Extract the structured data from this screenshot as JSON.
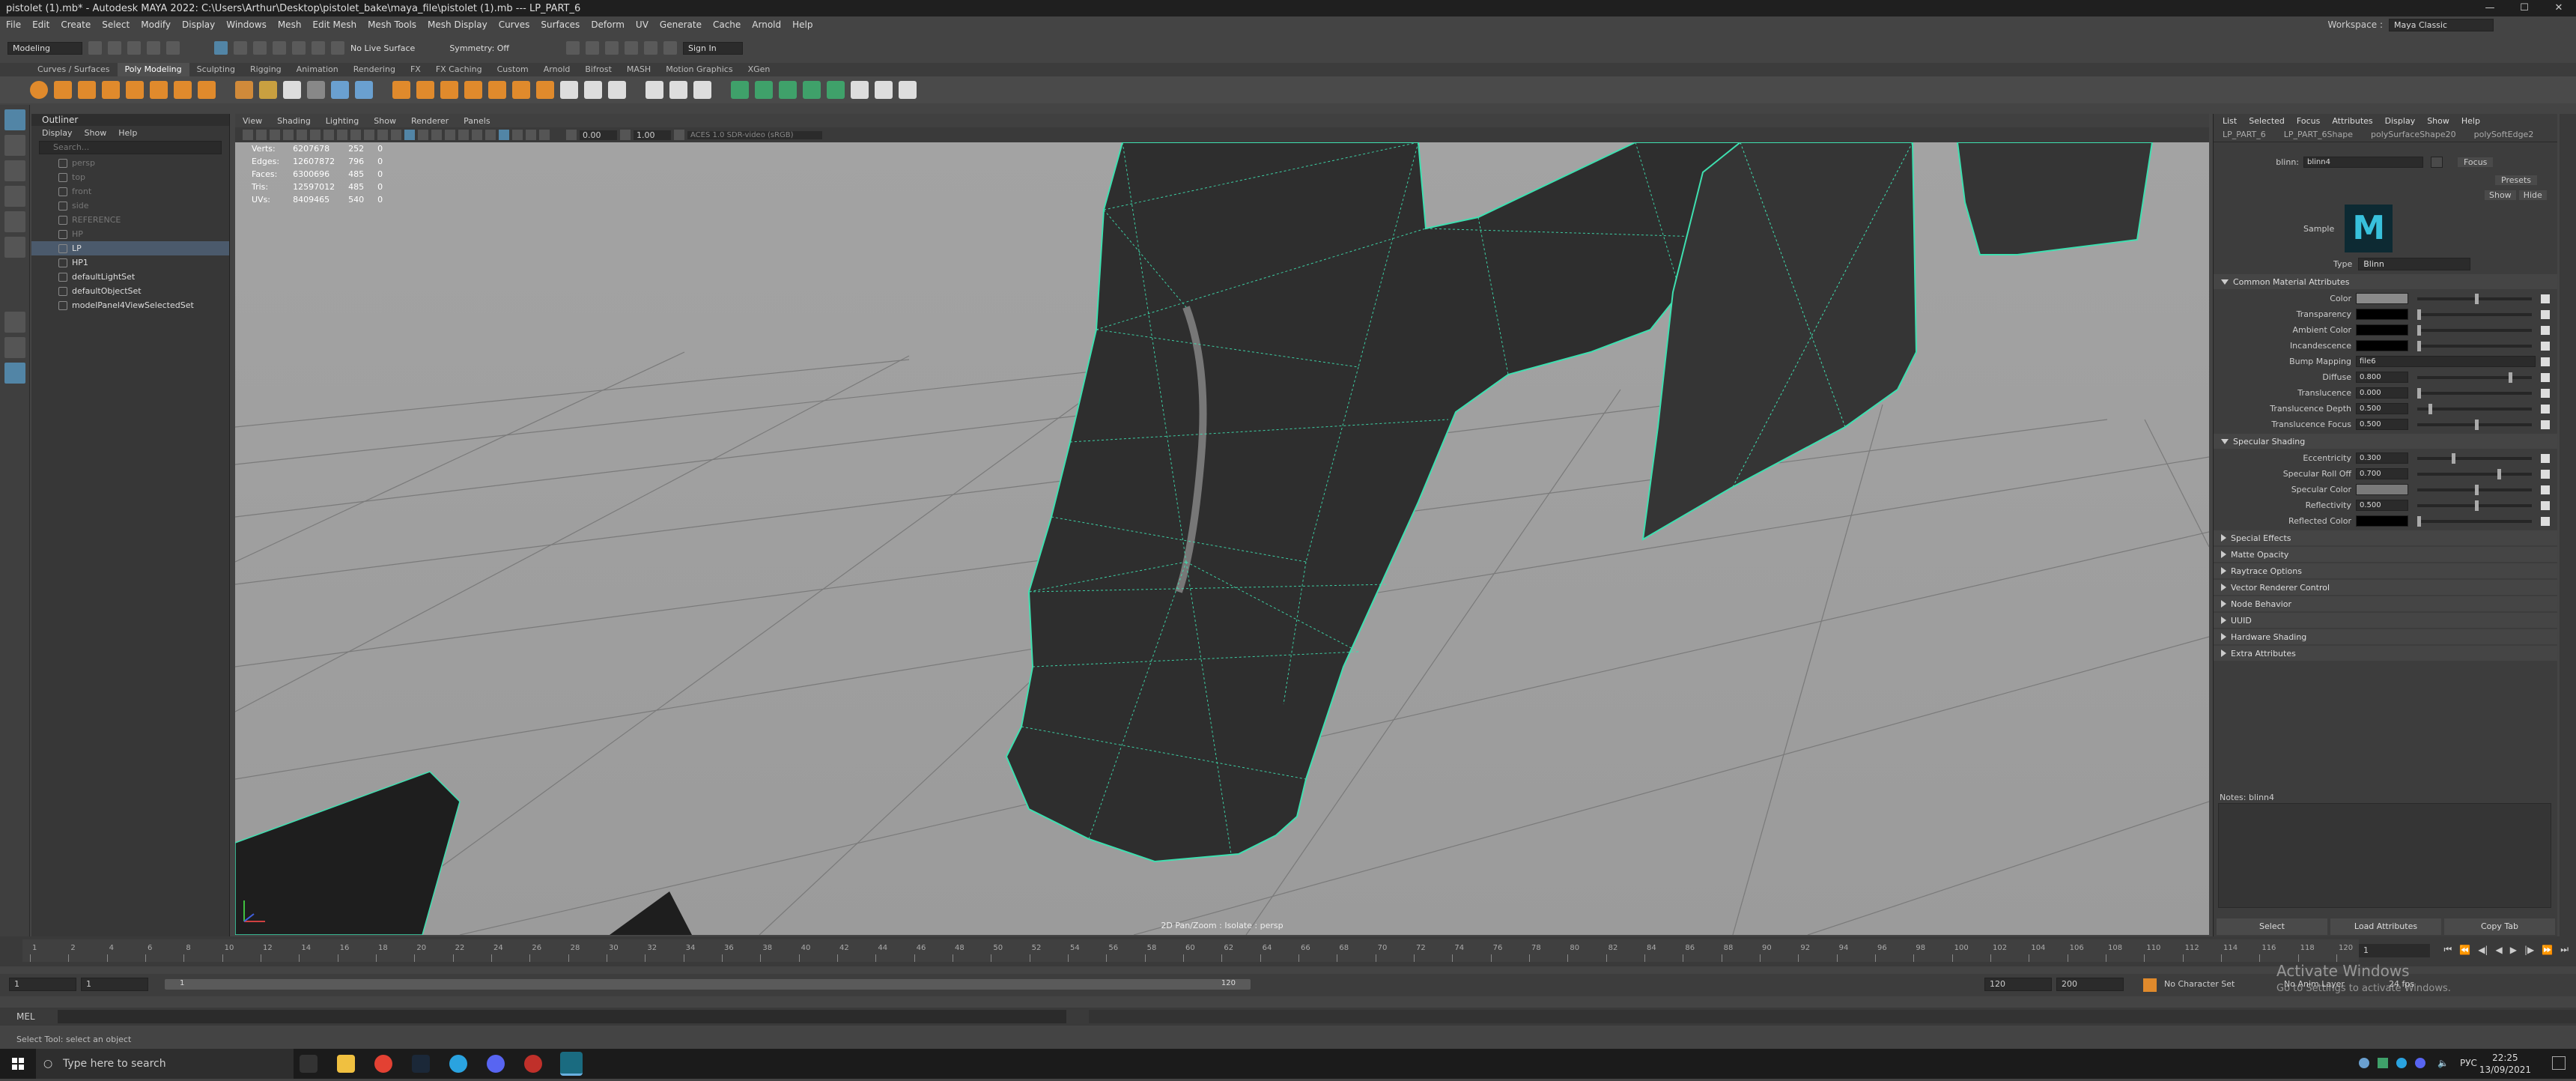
{
  "titlebar": {
    "title": "pistolet (1).mb* - Autodesk MAYA 2022: C:\\Users\\Arthur\\Desktop\\pistolet_bake\\maya_file\\pistolet (1).mb  ---  LP_PART_6",
    "minimize": "—",
    "maximize": "☐",
    "close": "✕"
  },
  "menubar": {
    "items": [
      "File",
      "Edit",
      "Create",
      "Select",
      "Modify",
      "Display",
      "Windows",
      "Mesh",
      "Edit Mesh",
      "Mesh Tools",
      "Mesh Display",
      "Curves",
      "Surfaces",
      "Deform",
      "UV",
      "Generate",
      "Cache",
      "Arnold",
      "Help"
    ],
    "workspace_label": "Workspace :",
    "workspace_value": "Maya Classic"
  },
  "statusline": {
    "mode": "Modeling",
    "live_surface": "No Live Surface",
    "symmetry": "Symmetry: Off",
    "sign_in": "Sign In"
  },
  "shelf": {
    "tabs": [
      "Curves / Surfaces",
      "Poly Modeling",
      "Sculpting",
      "Rigging",
      "Animation",
      "Rendering",
      "FX",
      "FX Caching",
      "Custom",
      "Arnold",
      "Bifrost",
      "MASH",
      "Motion Graphics",
      "XGen"
    ],
    "active_tab": "Poly Modeling"
  },
  "outliner": {
    "title": "Outliner",
    "menu": [
      "Display",
      "Show",
      "Help"
    ],
    "search_placeholder": "Search...",
    "items": [
      {
        "label": "persp",
        "dim": true
      },
      {
        "label": "top",
        "dim": true
      },
      {
        "label": "front",
        "dim": true
      },
      {
        "label": "side",
        "dim": true
      },
      {
        "label": "REFERENCE",
        "dim": true
      },
      {
        "label": "HP",
        "dim": true
      },
      {
        "label": "LP",
        "dim": false,
        "selected": true
      },
      {
        "label": "HP1",
        "dim": false
      },
      {
        "label": "defaultLightSet",
        "dim": false
      },
      {
        "label": "defaultObjectSet",
        "dim": false
      },
      {
        "label": "modelPanel4ViewSelectedSet",
        "dim": false
      }
    ]
  },
  "viewport": {
    "menu": [
      "View",
      "Shading",
      "Lighting",
      "Show",
      "Renderer",
      "Panels"
    ],
    "exposure": "0.00",
    "gamma": "1.00",
    "colorspace": "ACES 1.0 SDR-video (sRGB)",
    "hud": [
      {
        "label": "Verts:",
        "a": "6207678",
        "b": "252",
        "c": "0"
      },
      {
        "label": "Edges:",
        "a": "12607872",
        "b": "796",
        "c": "0"
      },
      {
        "label": "Faces:",
        "a": "6300696",
        "b": "485",
        "c": "0"
      },
      {
        "label": "Tris:",
        "a": "12597012",
        "b": "485",
        "c": "0"
      },
      {
        "label": "UVs:",
        "a": "8409465",
        "b": "540",
        "c": "0"
      }
    ],
    "camera_label": "2D Pan/Zoom : Isolate : persp"
  },
  "attribute_editor": {
    "menu": [
      "List",
      "Selected",
      "Focus",
      "Attributes",
      "Display",
      "Show",
      "Help"
    ],
    "tabs": [
      "LP_PART_6",
      "LP_PART_6Shape",
      "polySurfaceShape20",
      "polySoftEdge2"
    ],
    "type_label": "blinn:",
    "name_value": "blinn4",
    "focus": "Focus",
    "presets": "Presets",
    "show": "Show",
    "hide": "Hide",
    "sample_label": "Sample",
    "shader_type_label": "Type",
    "shader_type_value": "Blinn",
    "sections": {
      "common": "Common Material Attributes",
      "specular": "Specular Shading"
    },
    "common_attrs": [
      {
        "label": "Color",
        "kind": "color",
        "swatch": "#8a8a8a",
        "level": 0.5
      },
      {
        "label": "Transparency",
        "kind": "color",
        "swatch": "#000000",
        "level": 0.0
      },
      {
        "label": "Ambient Color",
        "kind": "color",
        "swatch": "#000000",
        "level": 0.0
      },
      {
        "label": "Incandescence",
        "kind": "color",
        "swatch": "#000000",
        "level": 0.0
      },
      {
        "label": "Bump Mapping",
        "kind": "text",
        "value": "file6"
      },
      {
        "label": "Diffuse",
        "kind": "num",
        "value": "0.800",
        "level": 0.8
      },
      {
        "label": "Translucence",
        "kind": "num",
        "value": "0.000",
        "level": 0.0
      },
      {
        "label": "Translucence Depth",
        "kind": "num",
        "value": "0.500",
        "level": 0.1
      },
      {
        "label": "Translucence Focus",
        "kind": "num",
        "value": "0.500",
        "level": 0.5
      }
    ],
    "specular_attrs": [
      {
        "label": "Eccentricity",
        "kind": "num",
        "value": "0.300",
        "level": 0.3
      },
      {
        "label": "Specular Roll Off",
        "kind": "num",
        "value": "0.700",
        "level": 0.7
      },
      {
        "label": "Specular Color",
        "kind": "color",
        "swatch": "#7a7a7a",
        "level": 0.5
      },
      {
        "label": "Reflectivity",
        "kind": "num",
        "value": "0.500",
        "level": 0.5
      },
      {
        "label": "Reflected Color",
        "kind": "color",
        "swatch": "#000000",
        "level": 0.0
      }
    ],
    "collapsed_sections": [
      "Special Effects",
      "Matte Opacity",
      "Raytrace Options",
      "Vector Renderer Control",
      "Node Behavior",
      "UUID",
      "Hardware Shading",
      "Extra Attributes"
    ],
    "notes_label": "Notes:  blinn4",
    "buttons": [
      "Select",
      "Load Attributes",
      "Copy Tab"
    ]
  },
  "timeslider": {
    "ticks": [
      "1",
      "2",
      "4",
      "6",
      "8",
      "10",
      "12",
      "14",
      "16",
      "18",
      "20",
      "22",
      "24",
      "26",
      "28",
      "30",
      "32",
      "34",
      "36",
      "38",
      "40",
      "42",
      "44",
      "46",
      "48",
      "50",
      "52",
      "54",
      "56",
      "58",
      "60",
      "62",
      "64",
      "66",
      "68",
      "70",
      "72",
      "74",
      "76",
      "78",
      "80",
      "82",
      "84",
      "86",
      "88",
      "90",
      "92",
      "94",
      "96",
      "98",
      "100",
      "102",
      "104",
      "106",
      "108",
      "110",
      "112",
      "114",
      "116",
      "118",
      "120"
    ],
    "current_frame": "1"
  },
  "range": {
    "start": "1",
    "start2": "1",
    "inner_start": "1",
    "inner_end": "120",
    "end": "120",
    "end2": "200",
    "character_set": "No Character Set",
    "anim_layer": "No Anim Layer",
    "fps": "24 fps"
  },
  "cmdline": {
    "label": "MEL"
  },
  "helpline": {
    "text": "Select Tool: select an object"
  },
  "watermark": {
    "line1": "Activate Windows",
    "line2": "Go to Settings to activate Windows."
  },
  "taskbar": {
    "search_placeholder": "Type here to search",
    "lang": "РУС",
    "time": "22:25",
    "date": "13/09/2021"
  },
  "colors": {
    "accent": "#5285a6",
    "wire": "#3ee0b0",
    "selection": "#4b5a6c"
  }
}
